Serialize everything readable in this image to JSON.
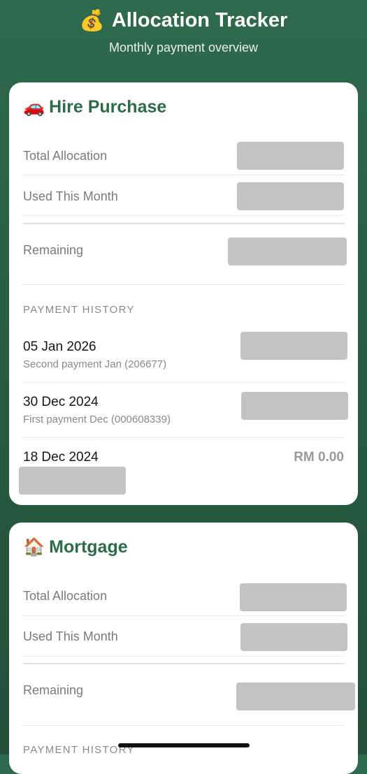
{
  "header": {
    "title": "Allocation Tracker",
    "title_icon": "money-bag-icon",
    "subtitle": "Monthly payment overview"
  },
  "colors": {
    "background": "#2f6a4c",
    "accent": "#2e6b4a",
    "card": "#ffffff",
    "redacted": "#c3c3c3"
  },
  "cards": [
    {
      "title": "Hire Purchase",
      "icon": "car-icon",
      "total_allocation_label": "Total Allocation",
      "used_label": "Used This Month",
      "remaining_label": "Remaining",
      "history_label": "PAYMENT HISTORY",
      "payments": [
        {
          "date": "05 Jan 2026",
          "description": "Second payment Jan (206677)"
        },
        {
          "date": "30 Dec 2024",
          "description": "First payment Dec (000608339)"
        },
        {
          "date": "18 Dec 2024",
          "amount": "RM 0.00"
        }
      ]
    },
    {
      "title": "Mortgage",
      "icon": "house-icon",
      "total_allocation_label": "Total Allocation",
      "used_label": "Used This Month",
      "remaining_label": "Remaining",
      "history_label": "PAYMENT HISTORY"
    }
  ]
}
